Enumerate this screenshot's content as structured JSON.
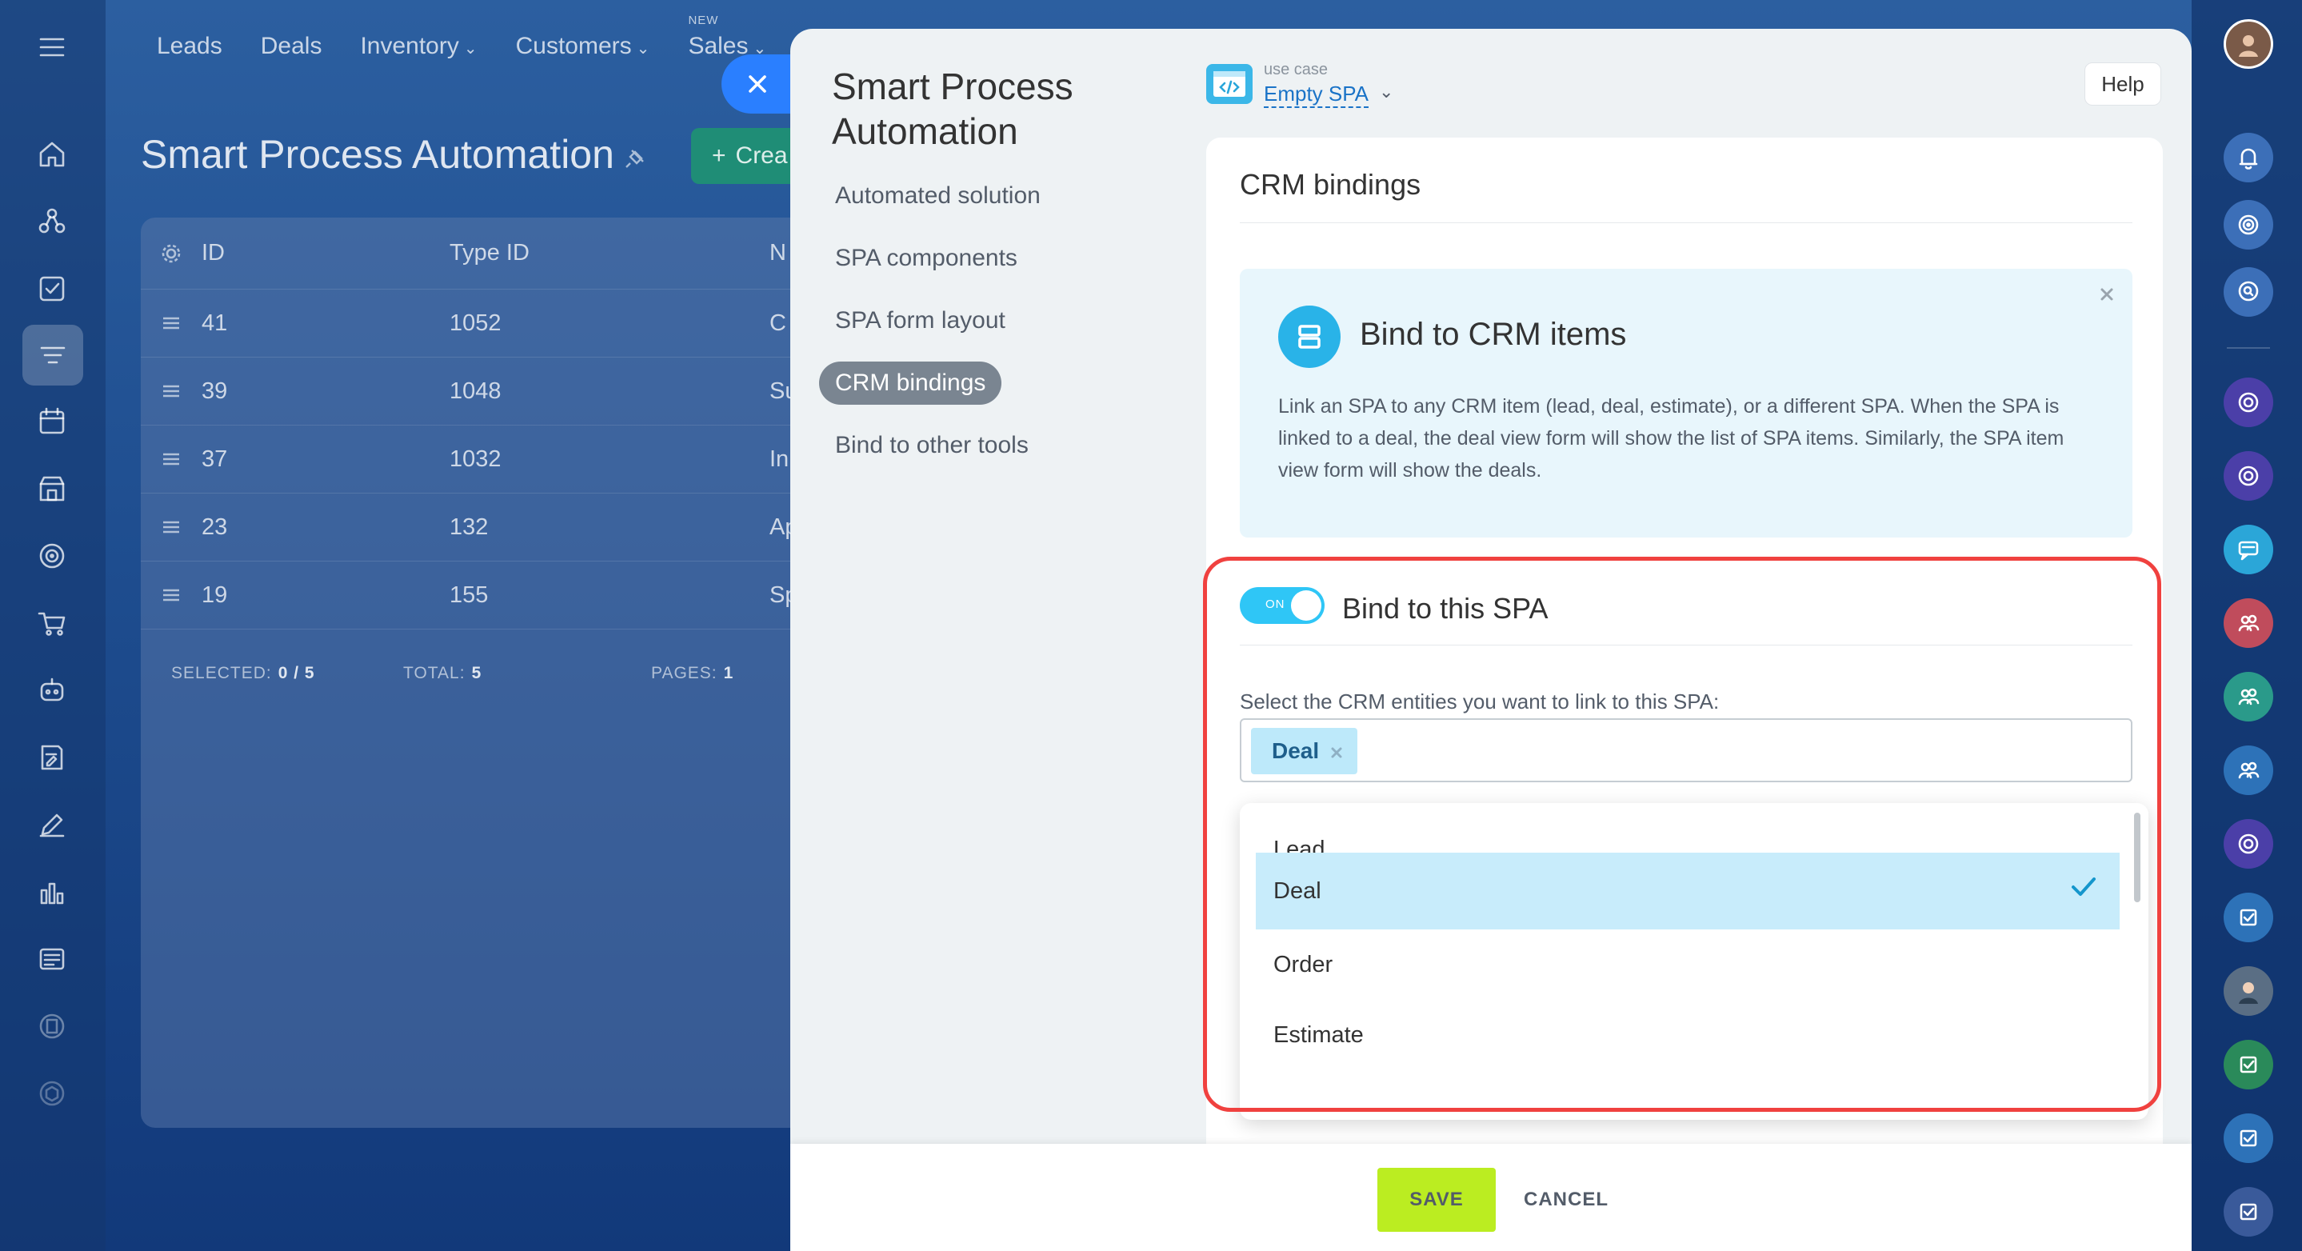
{
  "top_nav": {
    "items": [
      {
        "label": "Leads",
        "chevron": false,
        "badge": ""
      },
      {
        "label": "Deals",
        "chevron": false,
        "badge": ""
      },
      {
        "label": "Inventory",
        "chevron": true,
        "badge": ""
      },
      {
        "label": "Customers",
        "chevron": true,
        "badge": ""
      },
      {
        "label": "Sales",
        "chevron": true,
        "badge": "NEW"
      }
    ]
  },
  "page": {
    "title": "Smart Process Automation",
    "create_label": "Crea"
  },
  "bg_table": {
    "headers": [
      "ID",
      "Type ID",
      "N"
    ],
    "rows": [
      {
        "id": "41",
        "type_id": "1052",
        "name": "C"
      },
      {
        "id": "39",
        "type_id": "1048",
        "name": "Su"
      },
      {
        "id": "37",
        "type_id": "1032",
        "name": "In"
      },
      {
        "id": "23",
        "type_id": "132",
        "name": "Ap"
      },
      {
        "id": "19",
        "type_id": "155",
        "name": "Sp"
      }
    ],
    "footer": {
      "selected_label": "SELECTED:",
      "selected_value": "0 / 5",
      "total_label": "TOTAL:",
      "total_value": "5",
      "pages_label": "PAGES:",
      "pages_value": "1"
    }
  },
  "slider": {
    "title": "Smart Process Automation",
    "menu": [
      {
        "label": "Automated solution",
        "active": false
      },
      {
        "label": "SPA components",
        "active": false
      },
      {
        "label": "SPA form layout",
        "active": false
      },
      {
        "label": "CRM bindings",
        "active": true
      },
      {
        "label": "Bind to other tools",
        "active": false
      }
    ],
    "use_case": {
      "label": "use case",
      "value": "Empty SPA"
    },
    "help_label": "Help",
    "section_title": "CRM bindings",
    "info": {
      "title": "Bind to CRM items",
      "text": "Link an SPA to any CRM item (lead, deal, estimate), or a different SPA. When the SPA is linked to a deal, the deal view form will show the list of SPA items. Similarly, the SPA item view form will show the deals."
    },
    "bind": {
      "toggle_label": "ON",
      "toggle_on": true,
      "title": "Bind to this SPA",
      "select_label": "Select the CRM entities you want to link to this SPA:",
      "selected_tags": [
        "Deal"
      ],
      "options": [
        {
          "label": "Lead",
          "selected": false
        },
        {
          "label": "Deal",
          "selected": true
        },
        {
          "label": "Order",
          "selected": false
        },
        {
          "label": "Estimate",
          "selected": false
        }
      ]
    },
    "footer": {
      "save_label": "SAVE",
      "cancel_label": "CANCEL"
    }
  },
  "colors": {
    "accent": "#2fc6f6",
    "save": "#bbed21",
    "highlight": "#f0413f",
    "selected_option": "#c8ecfb"
  }
}
